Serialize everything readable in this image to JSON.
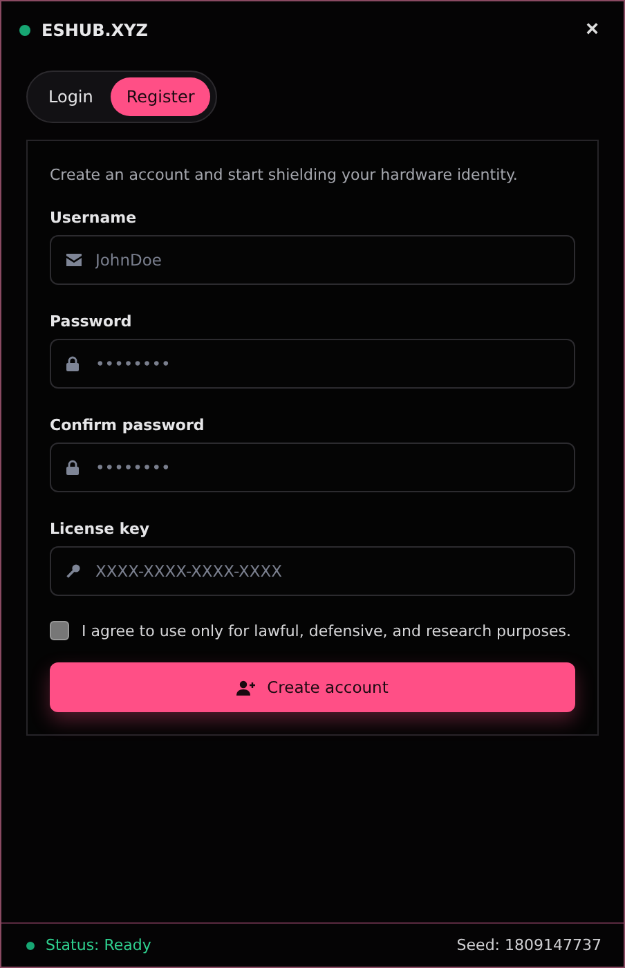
{
  "window": {
    "title": "ESHUB.XYZ",
    "close": "×",
    "online": true
  },
  "tabs": [
    {
      "label": "Login",
      "selected": false
    },
    {
      "label": "Register",
      "selected": true
    }
  ],
  "form": {
    "intro": "Create an account and start shielding your hardware identity.",
    "fields": [
      {
        "label": "Username",
        "kind": "mail",
        "placeholder": "JohnDoe"
      },
      {
        "label": "Password",
        "kind": "lock",
        "placeholder": "••••••••"
      },
      {
        "label": "Confirm password",
        "kind": "lock",
        "placeholder": "••••••••"
      },
      {
        "label": "License key",
        "kind": "key",
        "placeholder": "XXXX-XXXX-XXXX-XXXX"
      }
    ],
    "agree": {
      "label": "I agree to use only for lawful, defensive, and research purposes.",
      "checked": false
    },
    "submit": "Create account"
  },
  "status_bar": {
    "status": "Status: Ready",
    "seed": "Seed: 1809147737"
  }
}
